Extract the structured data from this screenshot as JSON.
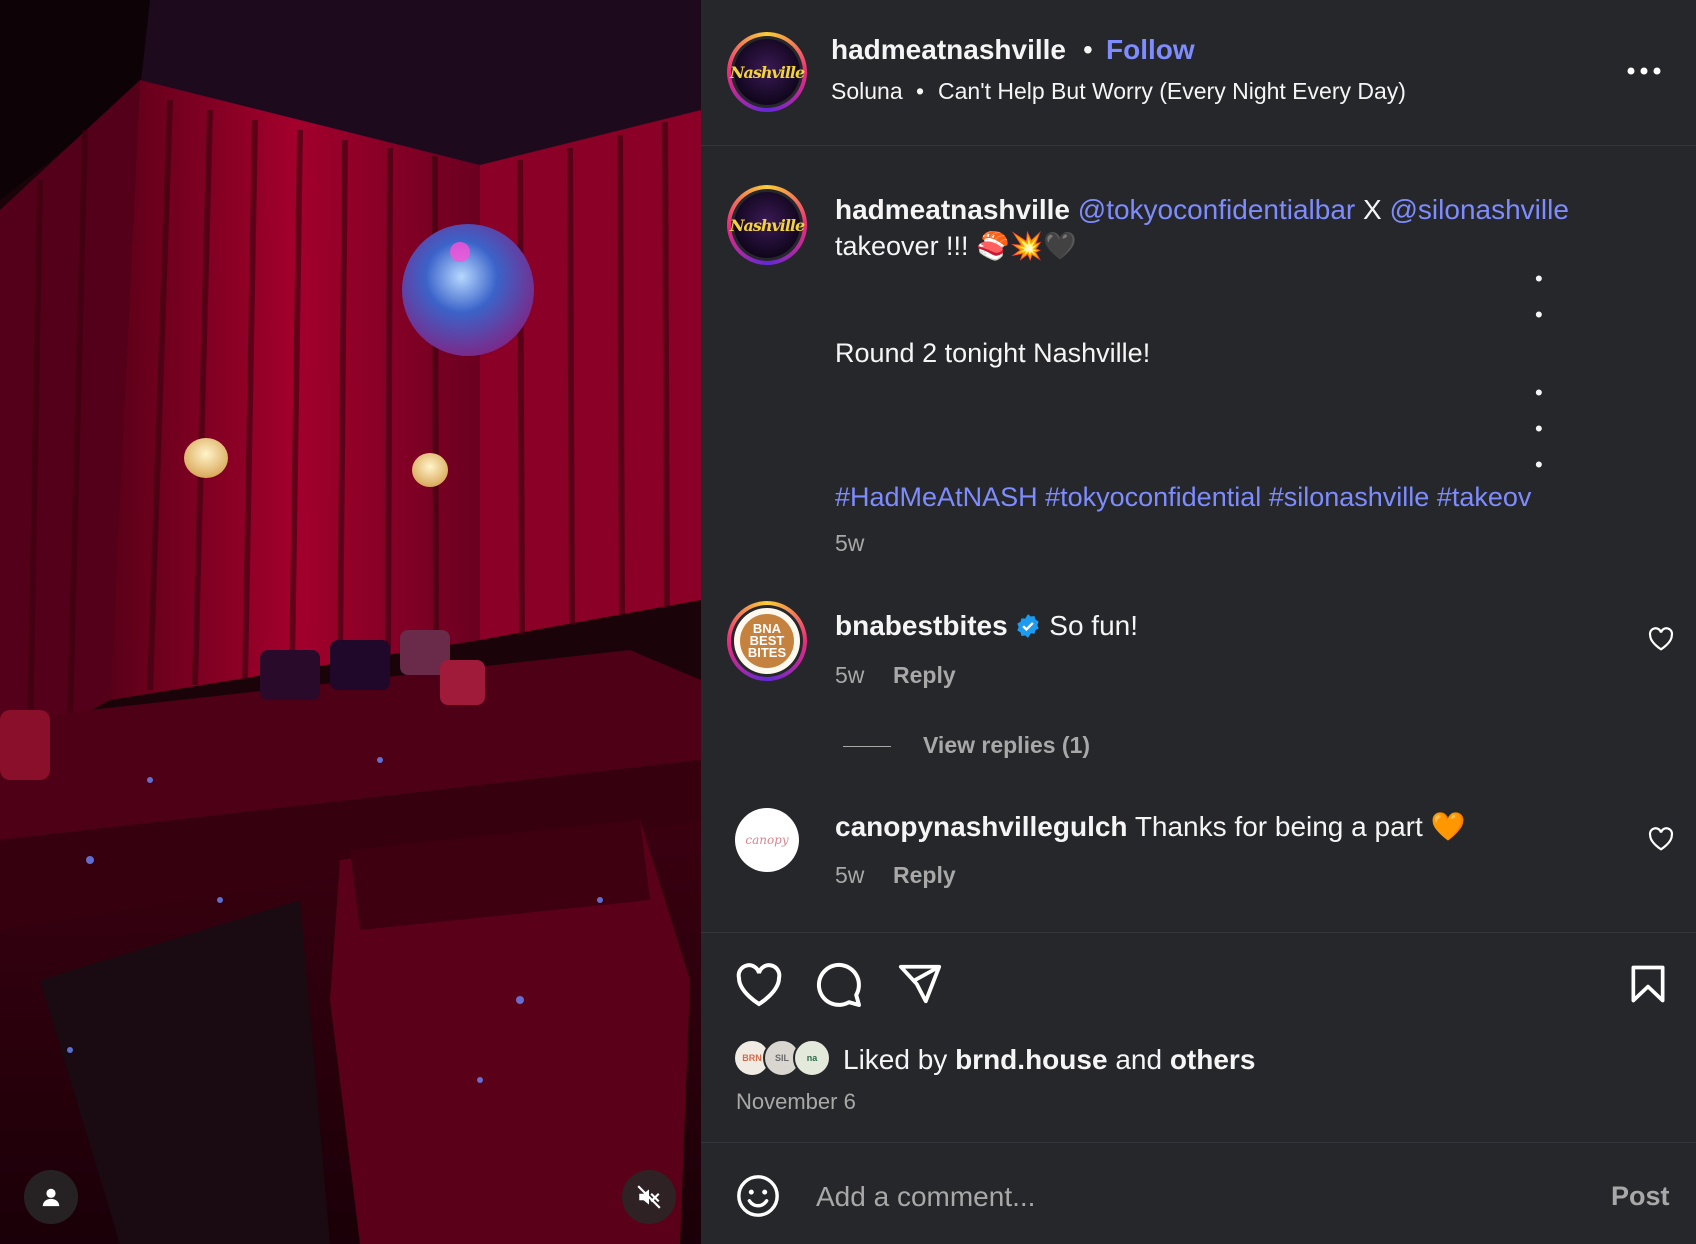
{
  "header": {
    "username": "hadmeatnashville",
    "separator": "•",
    "follow_label": "Follow",
    "audio_artist": "Soluna",
    "audio_separator": "•",
    "audio_track": "Can't Help But Worry (Every Night Every Day)",
    "avatar_logo_text": "Nashville"
  },
  "caption": {
    "username": "hadmeatnashville",
    "mention1": "@tokyoconfidentialbar",
    "connector": "X",
    "mention2": "@silonashville",
    "line2": "takeover !!! 🍣💥🖤",
    "bullet": "•",
    "line_round": "Round 2 tonight Nashville!",
    "hashtags": "#HadMeAtNASH #tokyoconfidential #silonashville #takeov",
    "time": "5w"
  },
  "comments": [
    {
      "username": "bnabestbites",
      "text": "So fun!",
      "time": "5w",
      "reply_label": "Reply",
      "logo_text": "BNA BEST BITES",
      "view_replies": "View replies (1)"
    },
    {
      "username": "canopynashvillegulch",
      "text": "Thanks for being a part 🧡",
      "time": "5w",
      "reply_label": "Reply",
      "logo_text": "canopy"
    }
  ],
  "likes": {
    "prefix": "Liked by",
    "user": "brnd.house",
    "and": "and",
    "others": "others",
    "mini_avatars": [
      "BRN",
      "SIL",
      "na"
    ]
  },
  "date": "November 6",
  "comment_box": {
    "placeholder": "Add a comment...",
    "post_label": "Post"
  },
  "colors": {
    "link": "#7e8cff",
    "panel_bg": "#25272b",
    "verified": "#1d9bf0"
  },
  "icons": [
    "more-icon",
    "heart-icon",
    "comment-icon",
    "share-icon",
    "bookmark-icon",
    "emoji-icon",
    "user-icon",
    "mute-icon",
    "verified-icon"
  ]
}
